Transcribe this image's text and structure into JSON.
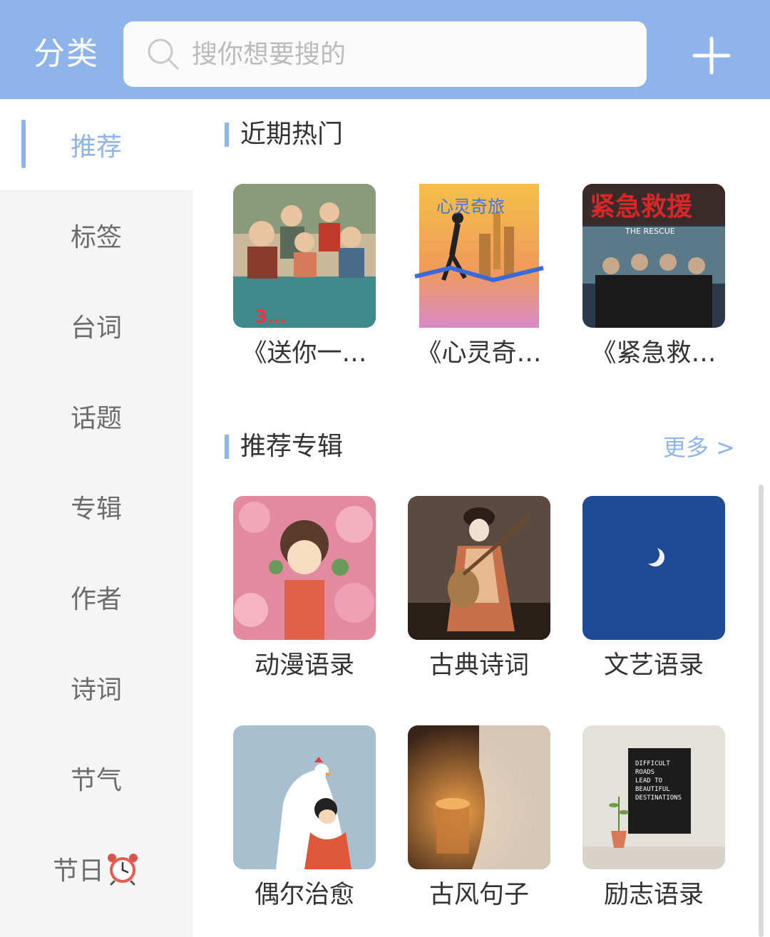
{
  "header": {
    "title": "分类",
    "search_placeholder": "搜你想要搜的",
    "add_icon": "plus-icon"
  },
  "sidebar": {
    "items": [
      {
        "label": "推荐",
        "active": true
      },
      {
        "label": "标签"
      },
      {
        "label": "台词"
      },
      {
        "label": "话题"
      },
      {
        "label": "专辑"
      },
      {
        "label": "作者"
      },
      {
        "label": "诗词"
      },
      {
        "label": "节气"
      },
      {
        "label": "节日",
        "icon": "alarm-clock-icon"
      }
    ]
  },
  "main": {
    "hot": {
      "title": "近期热门",
      "items": [
        {
          "label": "《送你一…"
        },
        {
          "label": "《心灵奇…"
        },
        {
          "label": "《紧急救…"
        }
      ]
    },
    "albums": {
      "title": "推荐专辑",
      "more": "更多 >",
      "items": [
        {
          "label": "动漫语录"
        },
        {
          "label": "古典诗词"
        },
        {
          "label": "文艺语录"
        },
        {
          "label": "偶尔治愈"
        },
        {
          "label": "古风句子"
        },
        {
          "label": "励志语录"
        }
      ]
    }
  },
  "colors": {
    "accent": "#8fb4ea",
    "sidebar_bg": "#f5f5f5",
    "text": "#333333"
  }
}
